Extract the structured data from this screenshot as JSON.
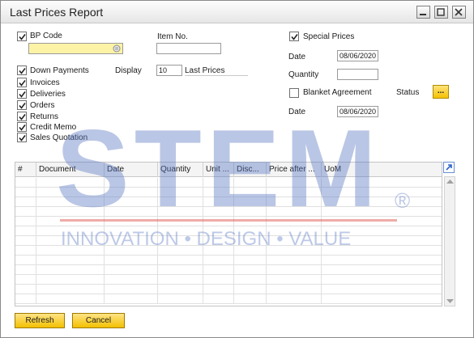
{
  "window": {
    "title": "Last Prices Report"
  },
  "filters": {
    "bp_code_label": "BP Code",
    "bp_code_value": "",
    "item_no_label": "Item No.",
    "item_no_value": "",
    "down_payments_label": "Down Payments",
    "display_label": "Display",
    "display_value": "10",
    "last_prices_label": "Last Prices",
    "checkboxes": [
      {
        "label": "Invoices",
        "checked": true
      },
      {
        "label": "Deliveries",
        "checked": true
      },
      {
        "label": "Orders",
        "checked": true
      },
      {
        "label": "Returns",
        "checked": true
      },
      {
        "label": "Credit Memo",
        "checked": true
      },
      {
        "label": "Sales Quotation",
        "checked": true
      }
    ],
    "special_prices_label": "Special Prices",
    "special_prices_checked": true,
    "date_label": "Date",
    "date_value": "08/06/2020",
    "quantity_label": "Quantity",
    "quantity_value": "",
    "blanket_agreement_label": "Blanket Agreement",
    "blanket_agreement_checked": false,
    "status_label": "Status",
    "status_button": "...",
    "date2_label": "Date",
    "date2_value": "08/06/2020"
  },
  "table": {
    "columns": [
      "#",
      "Document",
      "Date",
      "Quantity",
      "Unit ...",
      "Disc...",
      "Price after ...",
      "UoM"
    ]
  },
  "watermark": {
    "brand": "STEM",
    "registered": "®",
    "tagline": "INNOVATION • DESIGN • VALUE"
  },
  "footer": {
    "refresh_label": "Refresh",
    "cancel_label": "Cancel"
  },
  "colors": {
    "accent_yellow": "#f5c200",
    "input_highlight": "#fdf3a6",
    "watermark_blue": "#5b78c2",
    "watermark_red": "#d9463c"
  }
}
